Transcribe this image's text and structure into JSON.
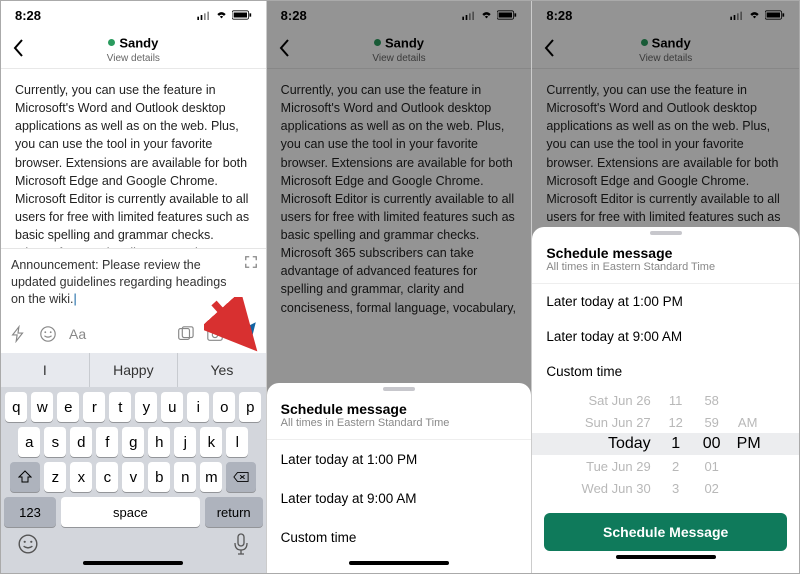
{
  "status": {
    "time": "8:28"
  },
  "nav": {
    "name": "Sandy",
    "sub": "View details"
  },
  "message_body": "Currently, you can use the feature in Microsoft's Word and Outlook desktop applications as well as on the web. Plus, you can use the tool in your favorite browser. Extensions are available for both Microsoft Edge and Google Chrome. Microsoft Editor is currently available to all users for free with limited features such as basic spelling and grammar checks. Microsoft 365 subscribers can take advantage of advanced features for spelling and grammar, clarity and conciseness, formal language, vocabulary,",
  "composer_text": "Announcement: Please review the updated guidelines regarding headings on the wiki.",
  "keyboard": {
    "predictions": [
      "I",
      "Happy",
      "Yes"
    ],
    "row1": [
      "q",
      "w",
      "e",
      "r",
      "t",
      "y",
      "u",
      "i",
      "o",
      "p"
    ],
    "row2": [
      "a",
      "s",
      "d",
      "f",
      "g",
      "h",
      "j",
      "k",
      "l"
    ],
    "row3": [
      "z",
      "x",
      "c",
      "v",
      "b",
      "n",
      "m"
    ],
    "num_key": "123",
    "space": "space",
    "return": "return"
  },
  "sheet": {
    "title": "Schedule message",
    "sub": "All times in Eastern Standard Time",
    "option1": "Later today at 1:00 PM",
    "option2": "Later today at 9:00 AM",
    "option3": "Custom time"
  },
  "picker": {
    "rows": [
      {
        "date": "Sat Jun 26",
        "h": "11",
        "m": "58",
        "ap": ""
      },
      {
        "date": "Sun Jun 27",
        "h": "12",
        "m": "59",
        "ap": "AM"
      },
      {
        "date": "Today",
        "h": "1",
        "m": "00",
        "ap": "PM"
      },
      {
        "date": "Tue Jun 29",
        "h": "2",
        "m": "01",
        "ap": ""
      },
      {
        "date": "Wed Jun 30",
        "h": "3",
        "m": "02",
        "ap": ""
      }
    ],
    "button": "Schedule Message"
  }
}
